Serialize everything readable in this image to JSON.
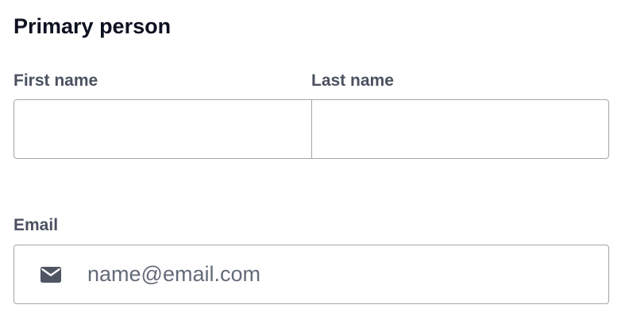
{
  "section": {
    "title": "Primary person"
  },
  "fields": {
    "first_name": {
      "label": "First name",
      "value": "",
      "placeholder": ""
    },
    "last_name": {
      "label": "Last name",
      "value": "",
      "placeholder": ""
    },
    "email": {
      "label": "Email",
      "value": "",
      "placeholder": "name@email.com",
      "icon": "envelope-icon"
    }
  },
  "colors": {
    "title_text": "#0d1120",
    "label_text": "#4b5160",
    "border": "#a3a6ad",
    "placeholder_text": "#646b79",
    "icon": "#4f5563"
  }
}
